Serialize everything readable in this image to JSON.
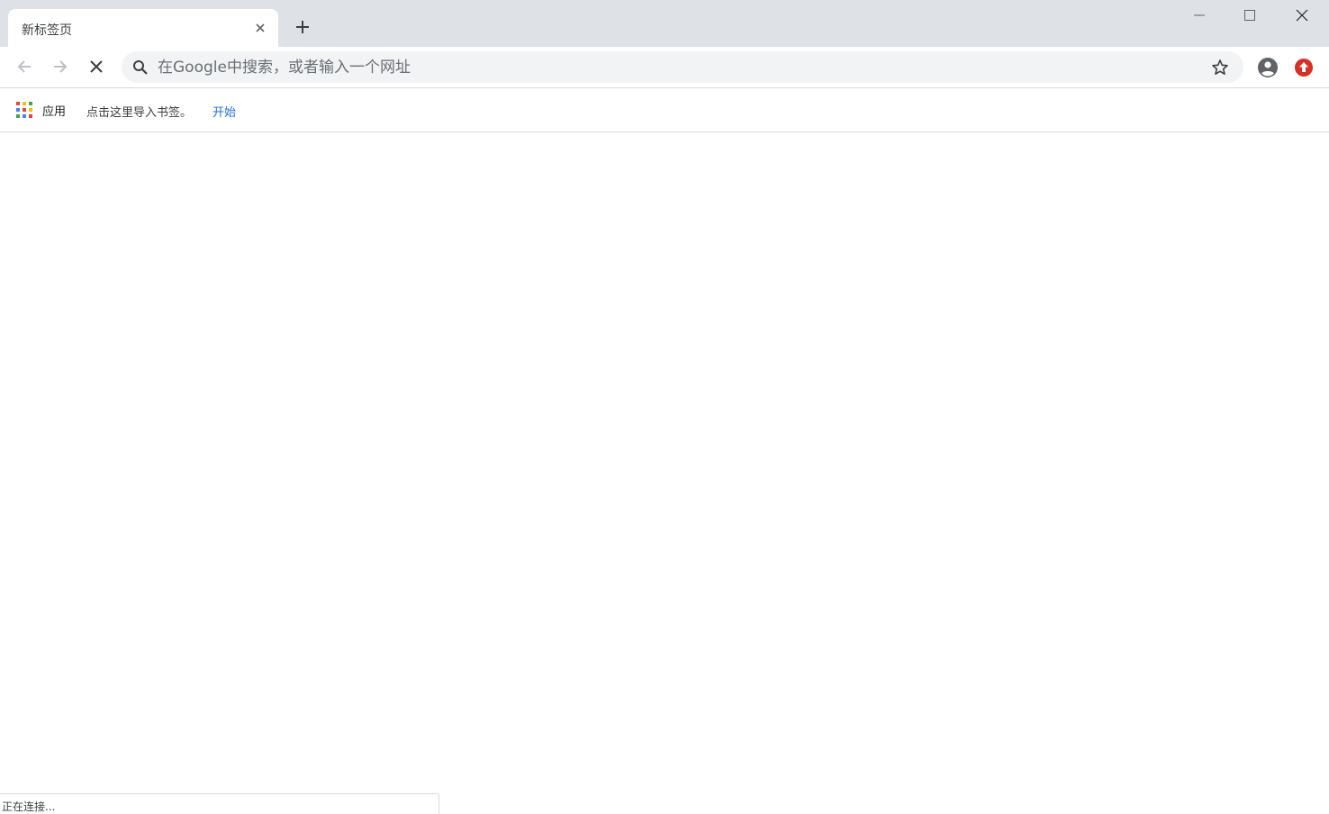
{
  "tab": {
    "title": "新标签页",
    "close_icon": "close-icon",
    "new_tab_icon": "plus-icon"
  },
  "window_controls": [
    "minimize-icon",
    "maximize-icon",
    "close-icon"
  ],
  "toolbar": {
    "back_icon": "arrow-left-icon",
    "forward_icon": "arrow-right-icon",
    "stop_icon": "stop-icon",
    "omnibox": {
      "placeholder": "在Google中搜索，或者输入一个网址",
      "value": ""
    },
    "bookmark_icon": "star-icon",
    "profile_icon": "account-circle-icon",
    "update_icon": "update-arrow-icon"
  },
  "bookmarks_bar": {
    "apps_label": "应用",
    "import_text": "点击这里导入书签。",
    "import_link": "开始"
  },
  "status": {
    "text": "正在连接..."
  },
  "colors": {
    "titlebar": "#dee1e6",
    "omnibox_bg": "#f1f3f4",
    "link": "#1a73e8",
    "update_badge": "#d93025",
    "apps_grid": [
      "#ea4335",
      "#fbbc04",
      "#34a853",
      "#4285f4",
      "#ea4335",
      "#fbbc04",
      "#34a853",
      "#4285f4",
      "#ea4335"
    ]
  }
}
